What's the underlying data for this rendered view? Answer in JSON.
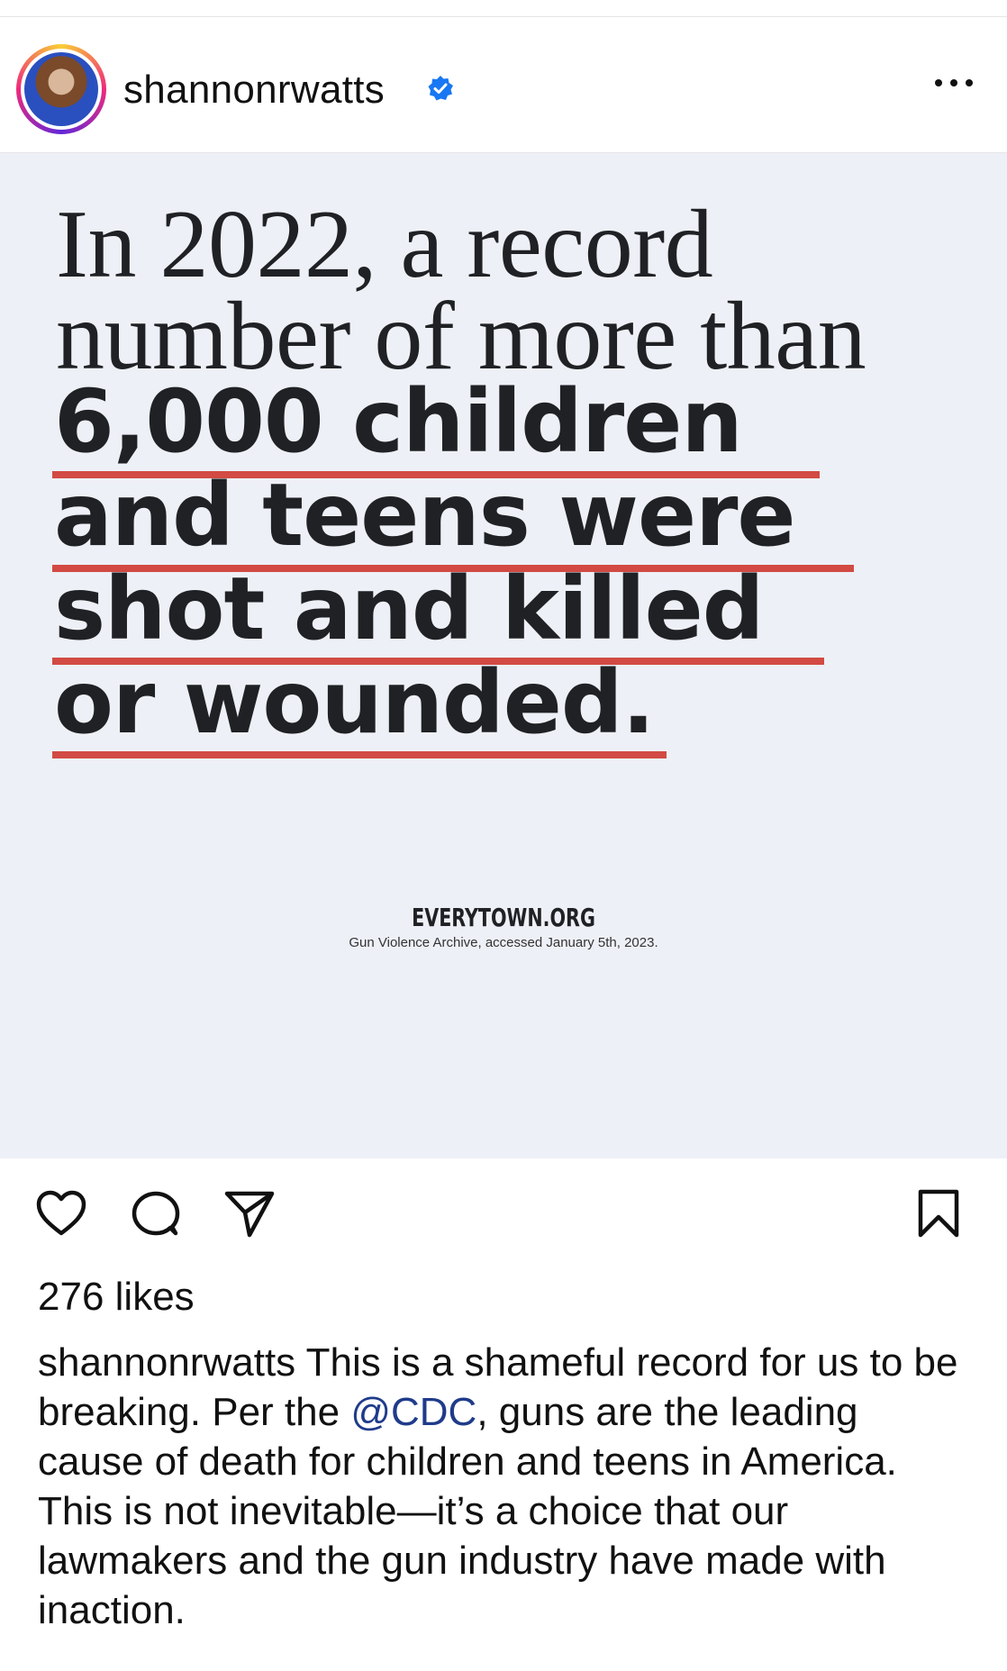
{
  "post": {
    "username": "shannonrwatts",
    "likes": "276 likes",
    "caption": {
      "username": "shannonrwatts",
      "text_before": " This is a shameful record for us to be breaking. Per the ",
      "mention": "@CDC",
      "text_after": ", guns are the leading cause of death for children and teens in America. This is not inevitable—it’s a choice that our lawmakers and the gun industry have made with inaction."
    }
  },
  "graphic": {
    "line1": "In 2022, a record",
    "line2": "number of more than",
    "line3": "6,000 children",
    "line4": "and teens were",
    "line5": "shot and killed",
    "line6": "or wounded.",
    "brand": "EVERYTOWN.ORG",
    "source": "Gun Violence Archive, accessed January 5th, 2023.",
    "underline_color": "#d24a43",
    "background_color": "#eef0f7"
  },
  "icons": {
    "verified": "verified-badge-icon",
    "more": "more-horizontal-icon",
    "like": "heart-icon",
    "comment": "comment-icon",
    "share": "send-icon",
    "save": "bookmark-icon"
  },
  "colors": {
    "verified": "#1877f2",
    "mention": "#1f3b8a"
  }
}
